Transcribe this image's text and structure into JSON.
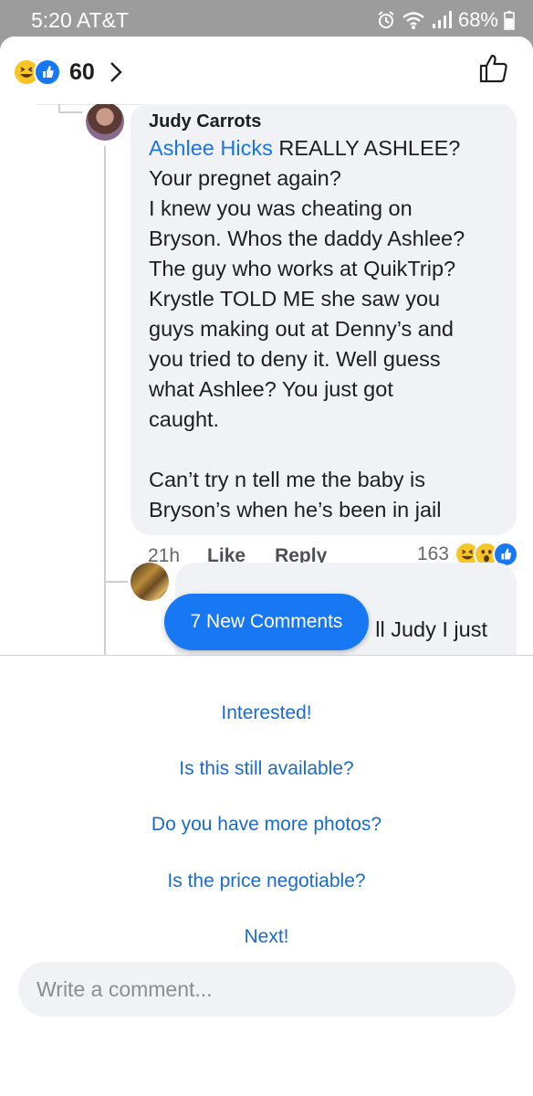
{
  "status": {
    "time": "5:20 AT&T",
    "battery": "68%",
    "icons": [
      "alarm-icon",
      "wifi-icon",
      "signal-icon",
      "battery-icon"
    ]
  },
  "reactions": {
    "count": "60",
    "types": [
      "laugh",
      "like"
    ]
  },
  "comment": {
    "author": "Judy Carrots",
    "mention": "Ashlee Hicks",
    "text": " REALLY ASHLEE?\nYour pregnet again?\nI knew you was cheating on\nBryson. Whos the daddy Ashlee?\nThe guy who works at QuikTrip?\nKrystle TOLD ME she saw you\nguys making out at Denny’s and\nyou tried to deny it. Well guess\nwhat Ashlee? You just got\ncaught.\n\nCan’t try n tell me the baby is\nBryson’s when he’s been in jail",
    "time": "21h",
    "like_label": "Like",
    "reply_label": "Reply",
    "reaction_count": "163",
    "reaction_types": [
      "laugh",
      "wow",
      "like"
    ]
  },
  "reply": {
    "snippet": "ll Judy I just"
  },
  "new_comments_label": "7 New Comments",
  "quick_replies": [
    "Interested!",
    "Is this still available?",
    "Do you have more photos?",
    "Is the price negotiable?",
    "Next!"
  ],
  "input": {
    "placeholder": "Write a comment..."
  },
  "colors": {
    "link_blue": "#1b74e4",
    "quick_reply_blue": "#1b6ac9",
    "pill_blue": "#1877f2",
    "bubble_gray": "#f0f2f5"
  }
}
